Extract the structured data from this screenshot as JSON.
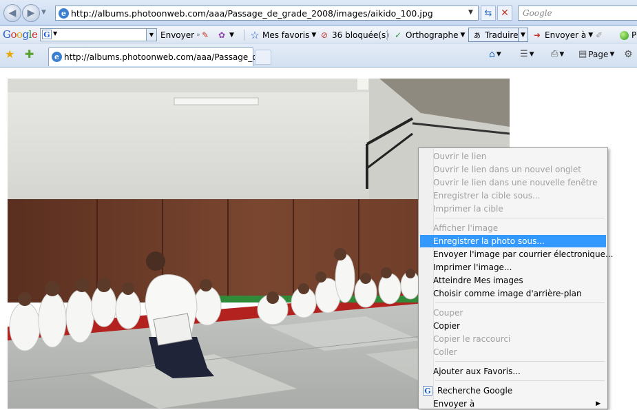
{
  "browser": {
    "address": {
      "url": "http://albums.photoonweb.com/aaa/Passage_de_grade_2008/images/aikido_100.jpg"
    },
    "search": {
      "placeholder": "Google"
    },
    "google_toolbar": {
      "logo": "Google",
      "send_label": "Envoyer",
      "favorites_label": "Mes favoris",
      "blocked_label": "36 bloquée(s)",
      "spelling_label": "Orthographe",
      "translate_label": "Traduire",
      "sendto_label": "Envoyer à",
      "overflow_label": "P"
    },
    "tabs": [
      {
        "title": "http://albums.photoonweb.com/aaa/Passage_de..."
      }
    ],
    "command_bar": {
      "page_label": "Page"
    }
  },
  "context_menu": {
    "items": [
      {
        "label": "Ouvrir le lien",
        "disabled": true
      },
      {
        "label": "Ouvrir le lien dans un nouvel onglet",
        "disabled": true
      },
      {
        "label": "Ouvrir le lien dans une nouvelle fenêtre",
        "disabled": true
      },
      {
        "label": "Enregistrer la cible sous...",
        "disabled": true
      },
      {
        "label": "Imprimer la cible",
        "disabled": true
      },
      {
        "label": "Afficher l'image",
        "disabled": true
      },
      {
        "label": "Enregistrer la photo sous...",
        "disabled": false,
        "highlighted": true
      },
      {
        "label": "Envoyer l'image par courrier électronique...",
        "disabled": false
      },
      {
        "label": "Imprimer l'image...",
        "disabled": false
      },
      {
        "label": "Atteindre Mes images",
        "disabled": false
      },
      {
        "label": "Choisir comme image d'arrière-plan",
        "disabled": false
      },
      {
        "label": "Couper",
        "disabled": true
      },
      {
        "label": "Copier",
        "disabled": false
      },
      {
        "label": "Copier le raccourci",
        "disabled": true
      },
      {
        "label": "Coller",
        "disabled": true
      },
      {
        "label": "Ajouter aux Favoris...",
        "disabled": false
      },
      {
        "label": "Recherche Google",
        "disabled": false
      },
      {
        "label": "Envoyer à",
        "disabled": false
      }
    ]
  },
  "colors": {
    "menu_highlight": "#3399ff",
    "menu_disabled_text": "#a0a0a0",
    "dojo_wall": "#6b3a26",
    "mat_grey": "#b9bcb8",
    "mat_red": "#b3221f"
  },
  "icons": [
    "back-icon",
    "forward-icon",
    "ie-page-icon",
    "refresh-icon",
    "stop-icon",
    "star-icon",
    "add-favorite-icon",
    "home-icon",
    "rss-icon",
    "print-icon",
    "page-icon",
    "tools-icon",
    "google-g-icon",
    "submenu-arrow-icon"
  ]
}
